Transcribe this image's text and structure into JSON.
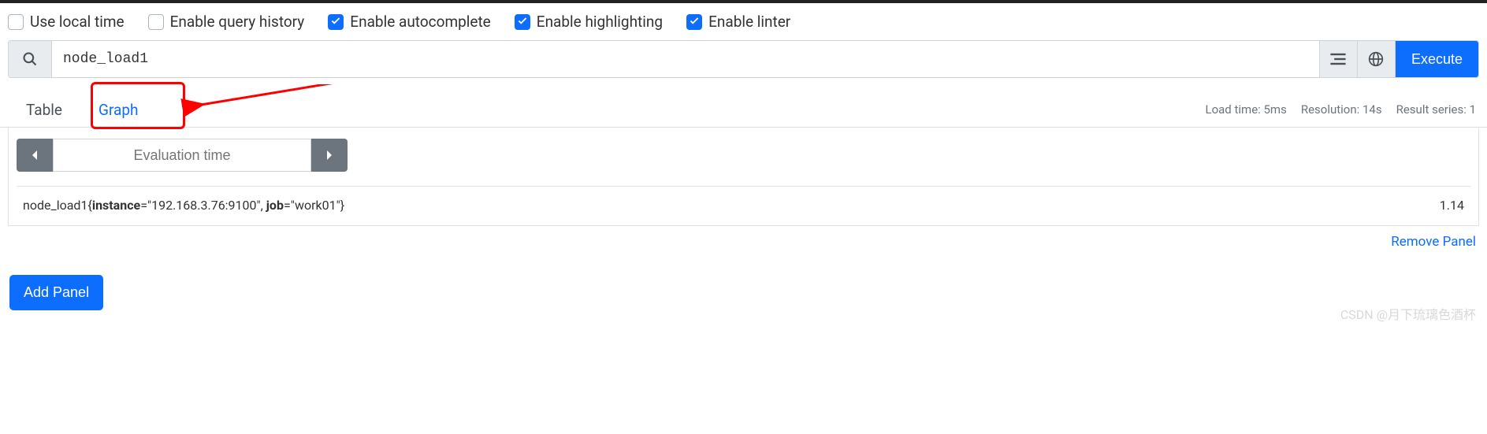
{
  "options": {
    "use_local_time": {
      "label": "Use local time",
      "checked": false
    },
    "enable_history": {
      "label": "Enable query history",
      "checked": false
    },
    "enable_autocomplete": {
      "label": "Enable autocomplete",
      "checked": true
    },
    "enable_highlighting": {
      "label": "Enable highlighting",
      "checked": true
    },
    "enable_linter": {
      "label": "Enable linter",
      "checked": true
    }
  },
  "query": {
    "value": "node_load1",
    "execute_label": "Execute"
  },
  "tabs": {
    "table": "Table",
    "graph": "Graph"
  },
  "status": {
    "load_time": "Load time: 5ms",
    "resolution": "Resolution: 14s",
    "result_series": "Result series: 1"
  },
  "eval_time": {
    "placeholder": "Evaluation time"
  },
  "result": {
    "metric": "node_load1",
    "instance_key": "instance",
    "instance_val": "=\"192.168.3.76:9100\", ",
    "job_key": "job",
    "job_val": "=\"work01\"}",
    "open_brace": "{",
    "value": "1.14"
  },
  "footer": {
    "remove_panel": "Remove Panel",
    "add_panel": "Add Panel"
  },
  "watermark": "CSDN @月下琉璃色酒杯"
}
